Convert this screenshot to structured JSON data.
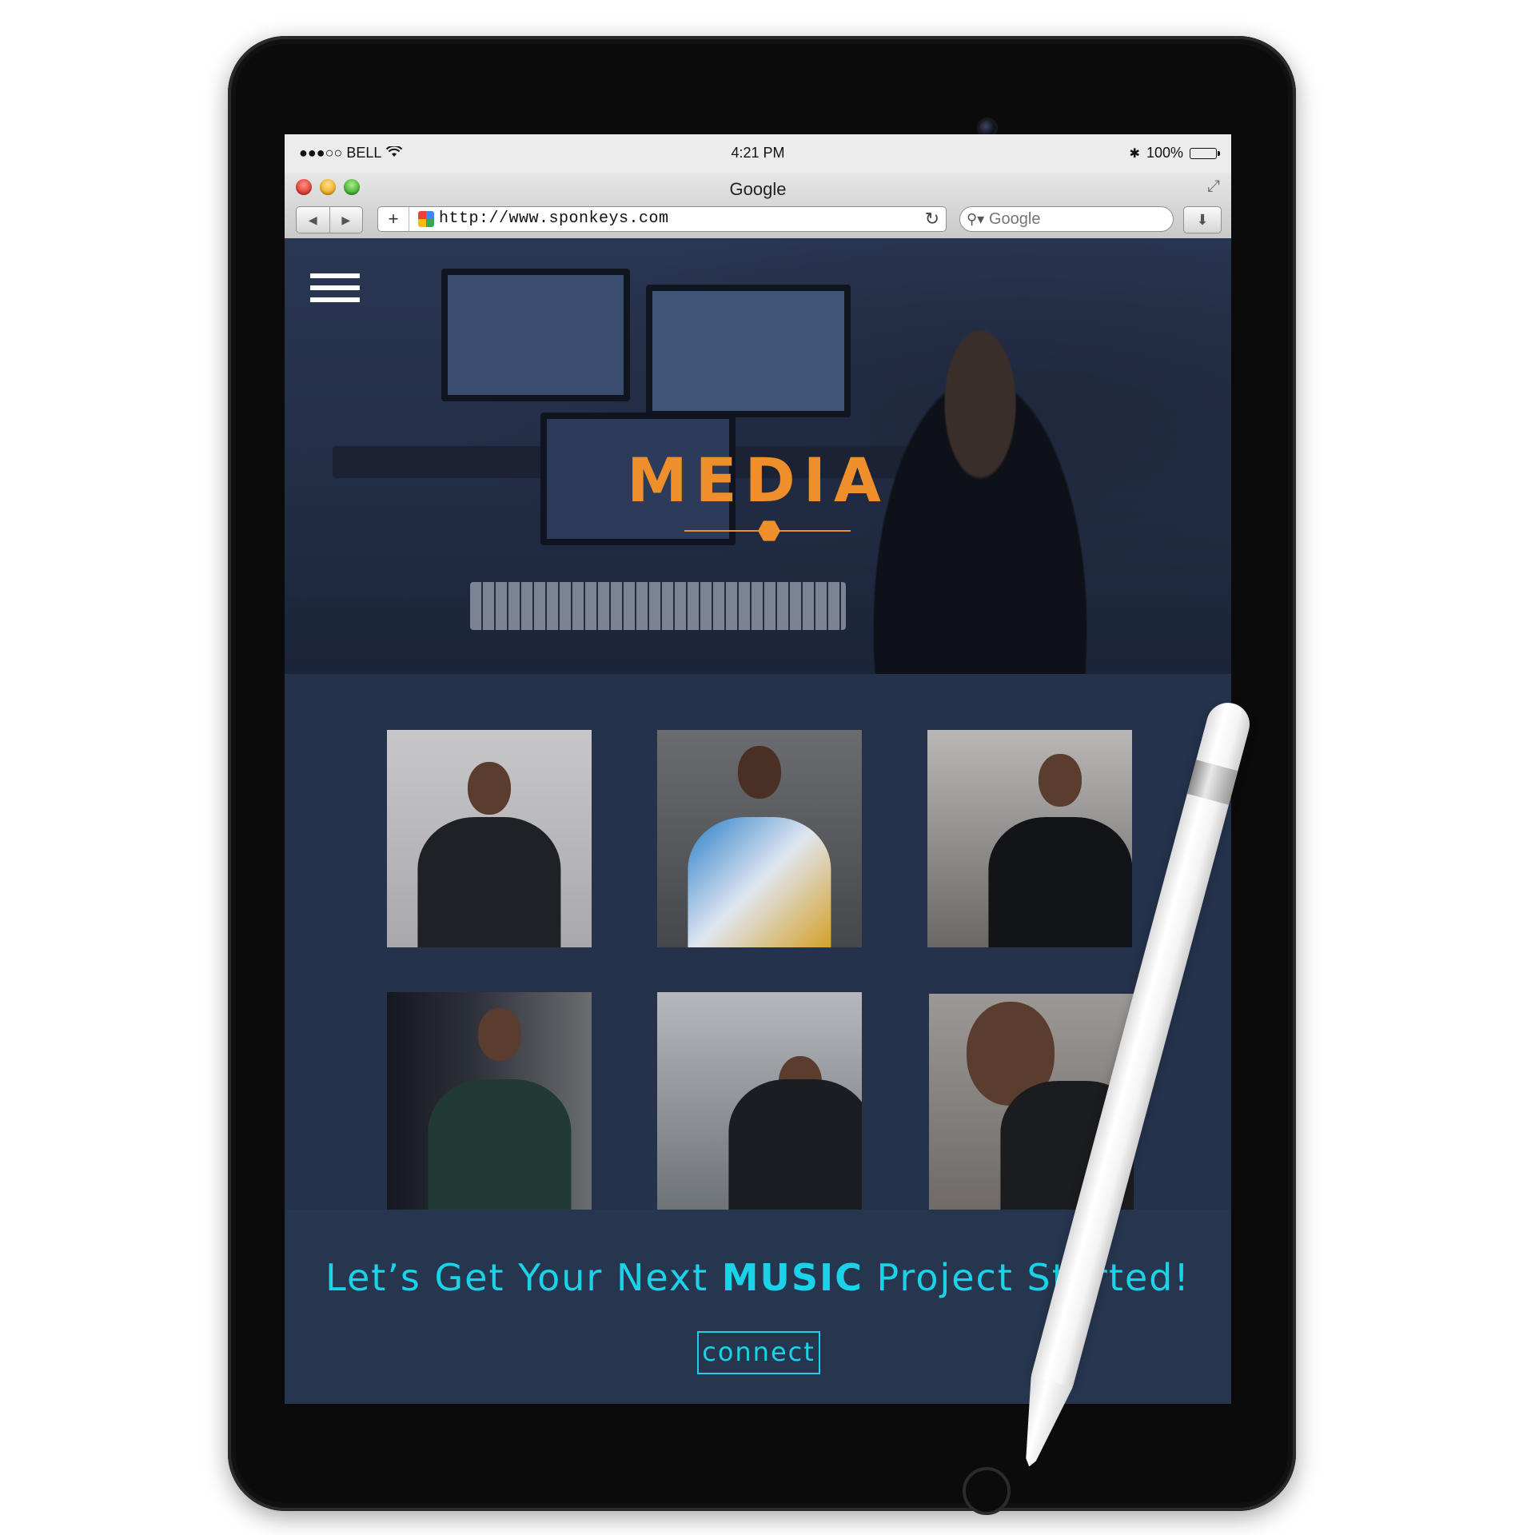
{
  "status_bar": {
    "carrier": "●●●○○ BELL",
    "time": "4:21 PM",
    "battery": "100%"
  },
  "browser": {
    "window_title": "Google",
    "url": "http://www.sponkeys.com",
    "search_placeholder": "Google"
  },
  "hero": {
    "title": "MEDIA",
    "accent_color": "#ee8f2c"
  },
  "gallery": {
    "photos": [
      {
        "label": "photo-1"
      },
      {
        "label": "photo-2"
      },
      {
        "label": "photo-3"
      },
      {
        "label": "photo-4"
      },
      {
        "label": "photo-5"
      },
      {
        "label": "photo-6"
      }
    ]
  },
  "cta": {
    "heading_before": "Let’s Get Your Next ",
    "heading_bold": "MUSIC",
    "heading_after": " Project Started!",
    "button_label": "connect",
    "accent_color": "#1cd2e8"
  },
  "icons": [
    "wifi-icon",
    "bluetooth-icon",
    "battery-icon",
    "hamburger-icon",
    "reload-icon",
    "search-icon",
    "download-icon",
    "back-icon",
    "forward-icon"
  ]
}
